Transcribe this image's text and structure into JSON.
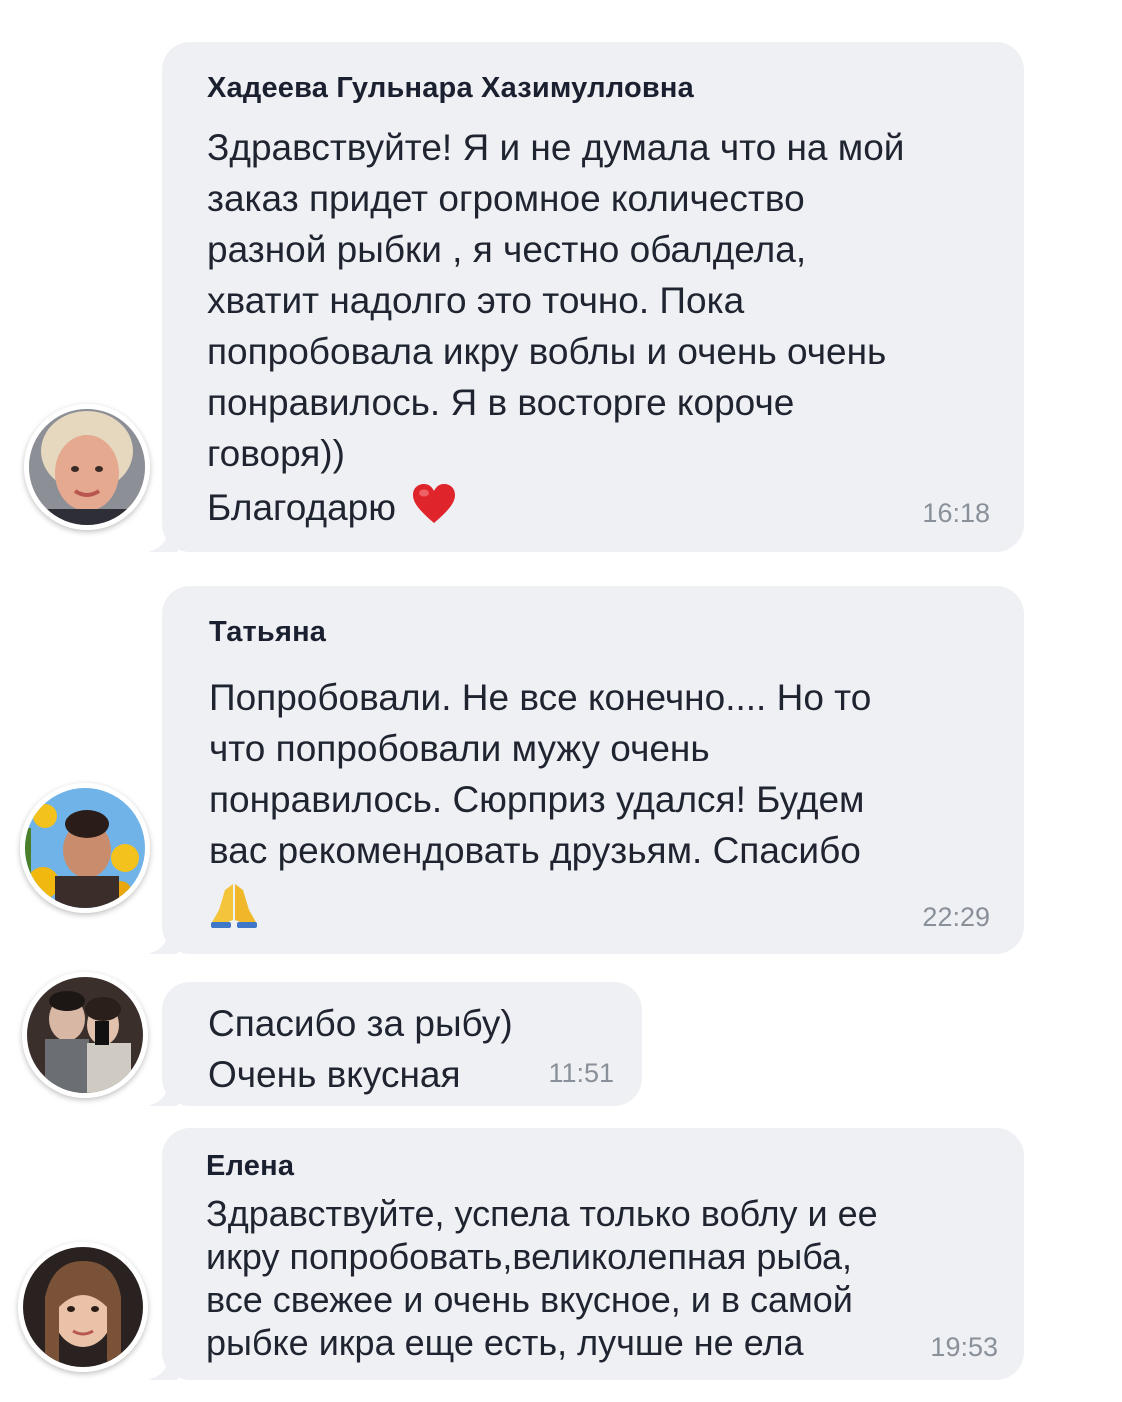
{
  "messages": [
    {
      "author": "Хадеева Гульнара Хазимулловна",
      "text": "Здравствуйте! Я и не думала что на мой\nзаказ придет огромное количество\nразной рыбки , я честно обалдела,\nхватит надолго это точно. Пока\nпопробовала икру воблы и очень очень\nпонравилось. Я в восторге короче\nговоря))",
      "last_line": "Благодарю",
      "emoji": "red-heart",
      "time": "16:18"
    },
    {
      "author": "Татьяна",
      "text": "Попробовали. Не все конечно.... Но то\nчто попробовали мужу очень\nпонравилось. Сюрприз удался! Будем\nвас рекомендовать друзьям. Спасибо",
      "emoji": "folded-hands",
      "time": "22:29"
    },
    {
      "author": "",
      "text": "Спасибо за рыбу)\nОчень вкусная",
      "time": "11:51"
    },
    {
      "author": "Елена",
      "text": "Здравствуйте, успела только воблу и ее\nикру попробовать,великолепная рыба,\nвсе свежее и очень вкусное, и в самой\nрыбке икра еще есть, лучше не ела",
      "time": "19:53"
    }
  ],
  "colors": {
    "bubble": "#eef0f3",
    "author": "#1b2030",
    "text": "#1f2430",
    "time": "#8a9099",
    "heart": "#e0242b"
  }
}
